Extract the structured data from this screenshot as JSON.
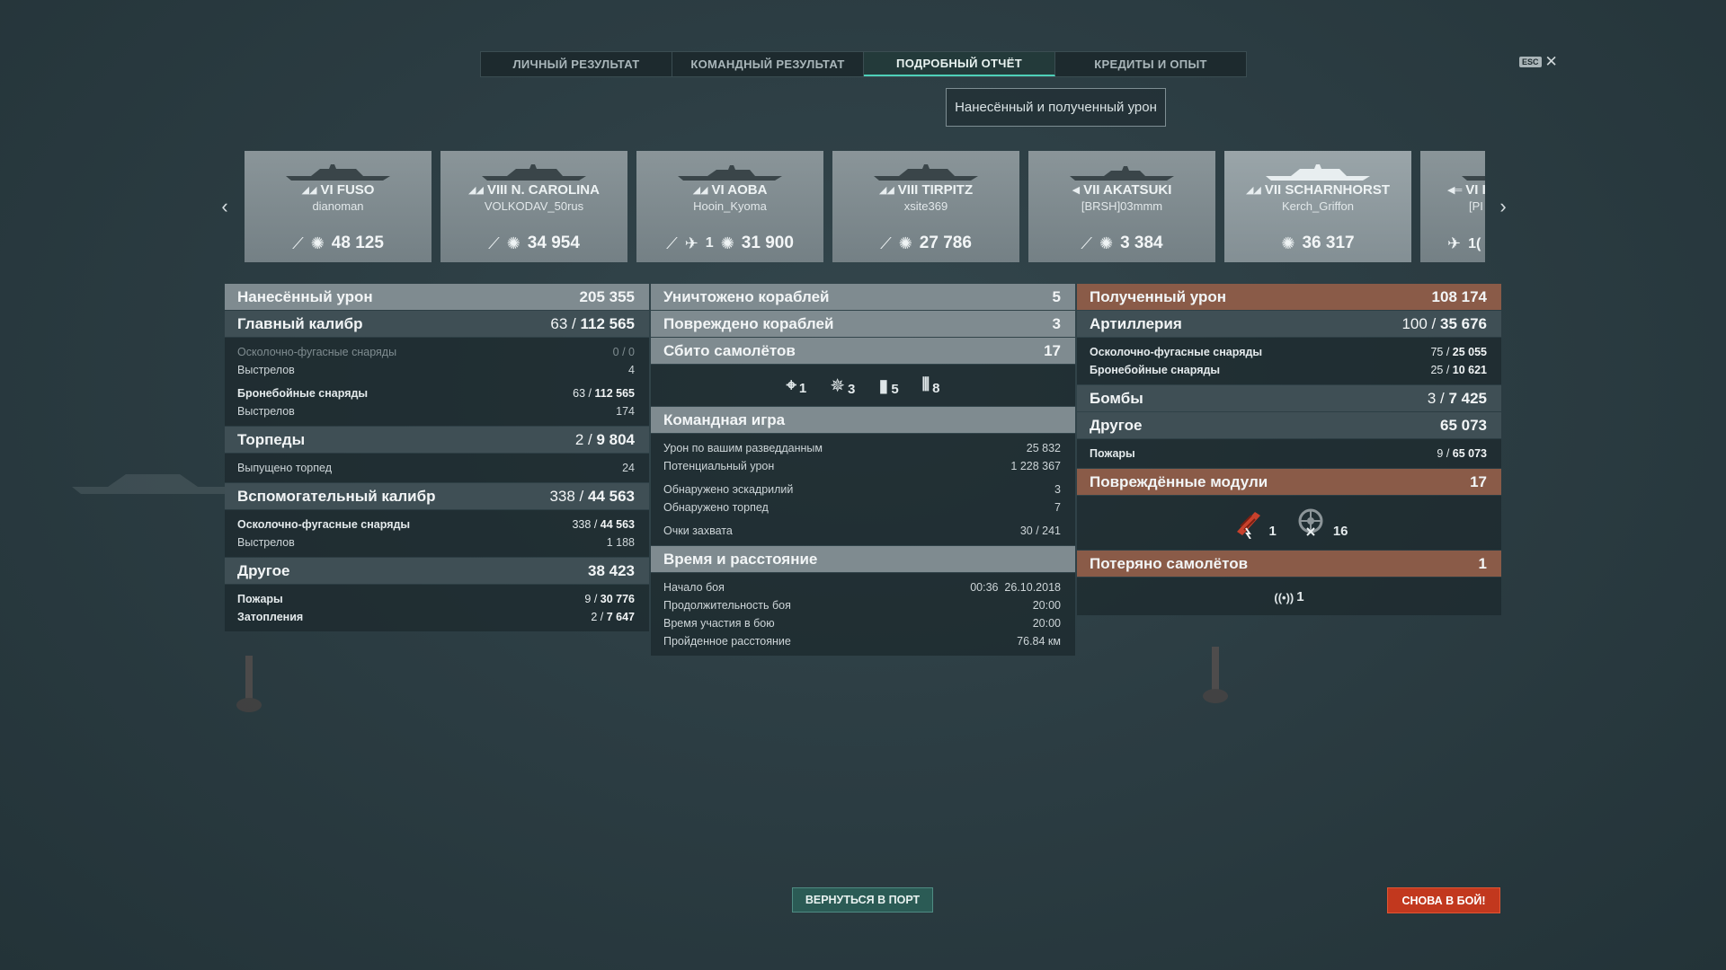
{
  "tabs": [
    {
      "label": "ЛИЧНЫЙ РЕЗУЛЬТАТ"
    },
    {
      "label": "КОМАНДНЫЙ РЕЗУЛЬТАТ"
    },
    {
      "label": "ПОДРОБНЫЙ ОТЧЁТ",
      "active": true
    },
    {
      "label": "КРЕДИТЫ И ОПЫТ"
    }
  ],
  "esc": {
    "badge": "ESC",
    "close": "✕"
  },
  "dropdown": {
    "value": "Нанесённый и полученный урон"
  },
  "carousel": {
    "prev_icon": "chevron-left-icon",
    "next_icon": "chevron-right-icon",
    "ships": [
      {
        "name": "VI FUSO",
        "player": "dianoman",
        "class_icon": "battleship-icon",
        "damage": "48 125",
        "planes": ""
      },
      {
        "name": "VIII N. CAROLINA",
        "player": "VOLKODAV_50rus",
        "class_icon": "battleship-icon",
        "damage": "34 954",
        "planes": ""
      },
      {
        "name": "VI AOBA",
        "player": "Hooin_Kyoma",
        "class_icon": "cruiser-icon",
        "damage": "31 900",
        "planes": "1"
      },
      {
        "name": "VIII TIRPITZ",
        "player": "xsite369",
        "class_icon": "battleship-icon",
        "damage": "27 786",
        "planes": ""
      },
      {
        "name": "VII AKATSUKI",
        "player": "[BRSH]03mmm",
        "class_icon": "destroyer-icon",
        "damage": "3 384",
        "planes": ""
      },
      {
        "name": "VII SCHARNHORST",
        "player": "Kerch_Griffon",
        "class_icon": "battleship-icon",
        "damage": "36 317",
        "planes": "",
        "selected": true
      },
      {
        "name": "VI I",
        "player": "[PI",
        "class_icon": "carrier-icon",
        "damage": "",
        "planes": "1("
      }
    ]
  },
  "dealt": {
    "title": "Нанесённый урон",
    "total": "205 355",
    "main": {
      "title": "Главный калибр",
      "hits": "63",
      "dmg": "112 565"
    },
    "main_rows": [
      {
        "label": "Осколочно-фугасные снаряды",
        "value": "0 / 0",
        "dim": true
      },
      {
        "label": "Выстрелов",
        "value": "4"
      },
      {
        "label": "Бронебойные снаряды",
        "hits": "63",
        "dmg": "112 565",
        "bold": true
      },
      {
        "label": "Выстрелов",
        "value": "174"
      }
    ],
    "torp": {
      "title": "Торпеды",
      "hits": "2",
      "dmg": "9 804"
    },
    "torp_rows": [
      {
        "label": "Выпущено торпед",
        "value": "24"
      }
    ],
    "sec": {
      "title": "Вспомогательный калибр",
      "hits": "338",
      "dmg": "44 563"
    },
    "sec_rows": [
      {
        "label": "Осколочно-фугасные снаряды",
        "hits": "338",
        "dmg": "44 563"
      },
      {
        "label": "Выстрелов",
        "value": "1 188"
      }
    ],
    "other": {
      "title": "Другое",
      "total": "38 423"
    },
    "other_rows": [
      {
        "label": "Пожары",
        "hits": "9",
        "dmg": "30 776"
      },
      {
        "label": "Затопления",
        "hits": "2",
        "dmg": "7 647"
      }
    ]
  },
  "middle": {
    "destroyed": {
      "title": "Уничтожено кораблей",
      "value": "5"
    },
    "damaged": {
      "title": "Повреждено кораблей",
      "value": "3"
    },
    "planes": {
      "title": "Сбито самолётов",
      "value": "17"
    },
    "plane_icons": [
      {
        "icon": "fighter-crosshair-icon",
        "glyph": "⌖",
        "count": "1"
      },
      {
        "icon": "aa-crosshair-icon",
        "glyph": "✵",
        "count": "3"
      },
      {
        "icon": "bomb-icon",
        "glyph": "▮",
        "count": "5"
      },
      {
        "icon": "aa-guns-icon",
        "glyph": "⫴",
        "count": "8"
      }
    ],
    "team": {
      "title": "Командная игра"
    },
    "team_rows": [
      {
        "label": "Урон по вашим разведданным",
        "value": "25 832"
      },
      {
        "label": "Потенциальный урон",
        "value": "1 228 367"
      },
      {
        "label": "Обнаружено эскадрилий",
        "value": "3"
      },
      {
        "label": "Обнаружено торпед",
        "value": "7"
      },
      {
        "label": "Очки захвата",
        "value": "30 / 241"
      }
    ],
    "time": {
      "title": "Время и расстояние"
    },
    "time_rows": [
      {
        "label": "Начало боя",
        "value": "00:36  26.10.2018"
      },
      {
        "label": "Продолжительность боя",
        "value": "20:00"
      },
      {
        "label": "Время участия в бою",
        "value": "20:00"
      },
      {
        "label": "Пройденное расстояние",
        "value": "76.84 км"
      }
    ]
  },
  "received": {
    "title": "Полученный урон",
    "total": "108 174",
    "art": {
      "title": "Артиллерия",
      "hits": "100",
      "dmg": "35 676"
    },
    "art_rows": [
      {
        "label": "Осколочно-фугасные снаряды",
        "hits": "75",
        "dmg": "25 055"
      },
      {
        "label": "Бронебойные снаряды",
        "hits": "25",
        "dmg": "10 621"
      }
    ],
    "bombs": {
      "title": "Бомбы",
      "hits": "3",
      "dmg": "7 425"
    },
    "other": {
      "title": "Другое",
      "total": "65 073"
    },
    "other_rows": [
      {
        "label": "Пожары",
        "hits": "9",
        "dmg": "65 073"
      }
    ],
    "modules": {
      "title": "Повреждённые модули",
      "value": "17"
    },
    "module_icons": [
      {
        "icon": "engine-damage-icon",
        "count": "1",
        "color": "#c8412c"
      },
      {
        "icon": "steering-damage-icon",
        "count": "16",
        "color": "#8c9599"
      }
    ],
    "lost": {
      "title": "Потеряно самолётов",
      "value": "1"
    },
    "lost_icons": [
      {
        "icon": "spotter-plane-icon",
        "glyph": "((•))",
        "count": "1"
      }
    ]
  },
  "buttons": {
    "port": "ВЕРНУТЬСЯ В ПОРТ",
    "battle": "СНОВА В БОЙ!"
  },
  "colors": {
    "accent": "#4ed0b8",
    "received_header": "#8a5b48",
    "battle_button": "#c2381e",
    "port_button": "#2b5b55"
  }
}
